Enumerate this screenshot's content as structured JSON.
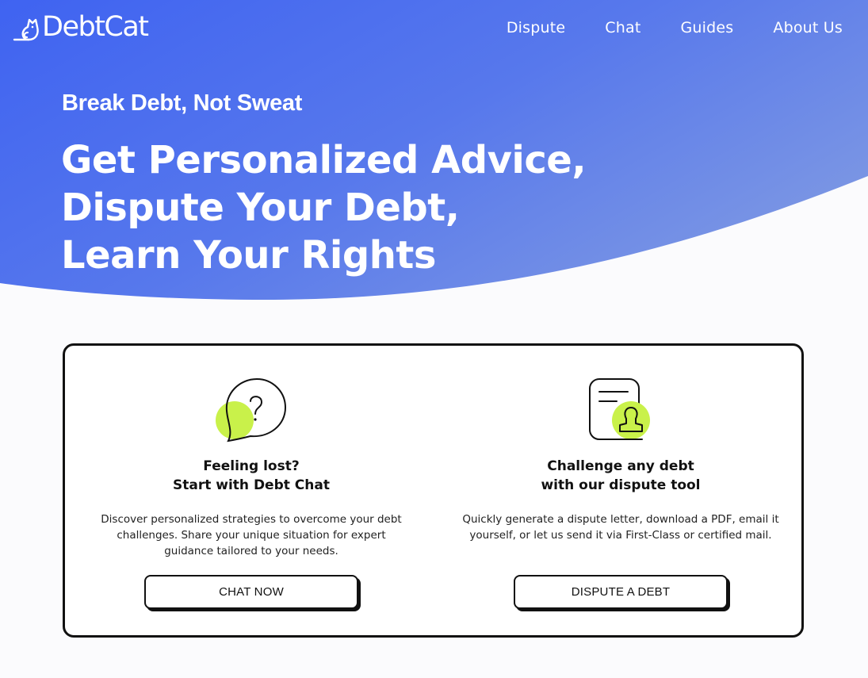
{
  "brand": {
    "name": "DebtCat"
  },
  "nav": {
    "items": [
      "Dispute",
      "Chat",
      "Guides",
      "About Us"
    ]
  },
  "hero": {
    "tagline": "Break Debt, Not Sweat",
    "headline": [
      "Get Personalized Advice,",
      "Dispute Your Debt,",
      "Learn Your Rights"
    ]
  },
  "features": [
    {
      "icon": "question-bubble-icon",
      "title": [
        "Feeling lost?",
        "Start with Debt Chat"
      ],
      "description": "Discover personalized strategies to overcome your debt challenges. Share your unique situation for expert guidance tailored to your needs.",
      "button": "CHAT NOW"
    },
    {
      "icon": "document-stamp-icon",
      "title": [
        "Challenge any debt",
        "with our dispute tool"
      ],
      "description": "Quickly generate a dispute letter, download a PDF, email it yourself, or let us send it via First-Class or certified mail.",
      "button": "DISPUTE A DEBT"
    }
  ],
  "colors": {
    "hero_start": "#3f66f0",
    "hero_end": "#6f8de6",
    "accent": "#c9f14a",
    "ink": "#111111"
  }
}
